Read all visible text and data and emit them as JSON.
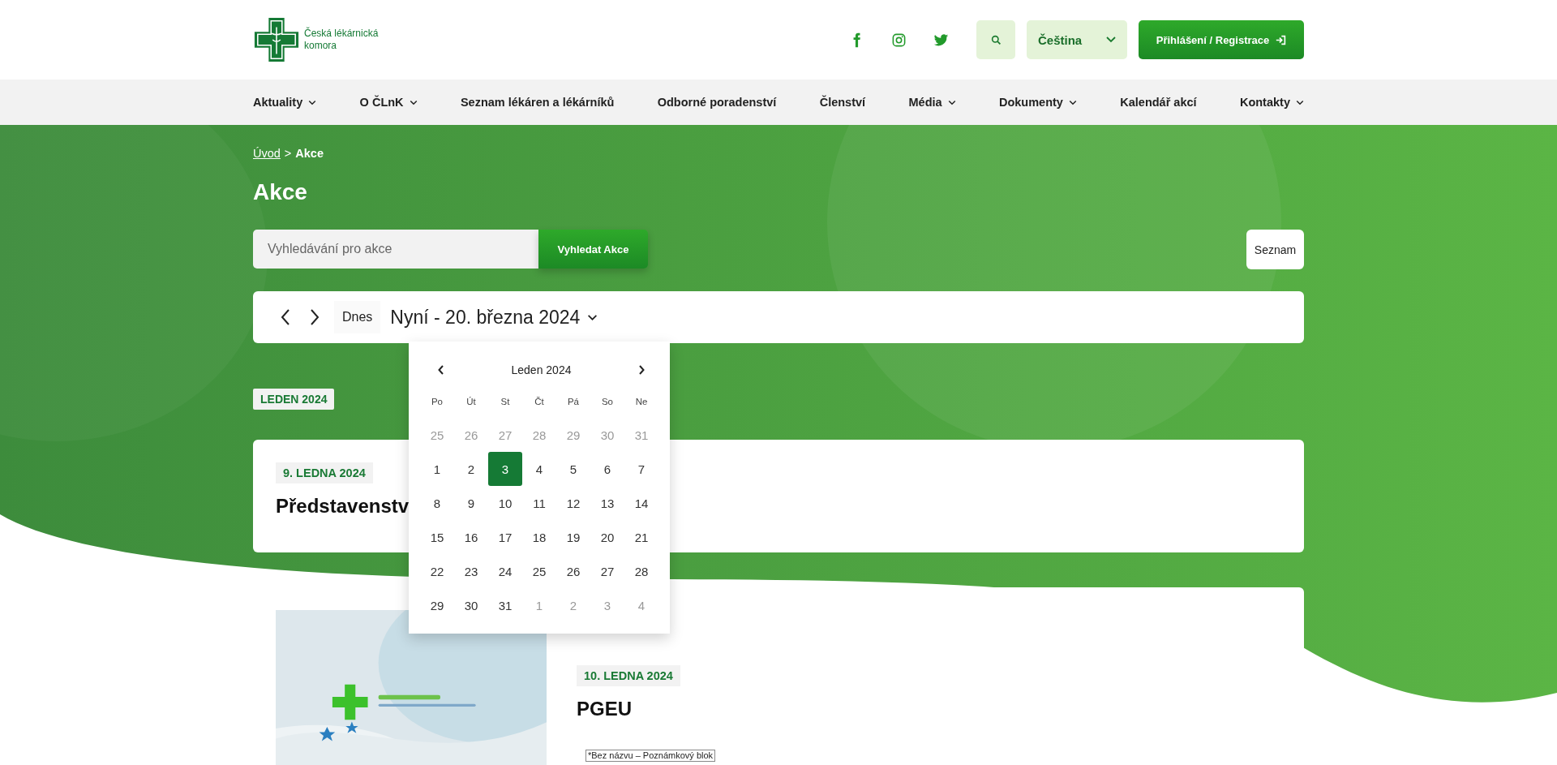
{
  "header": {
    "logo_text": "Česká lékárnická komora",
    "language": "Čeština",
    "login_button": "Přihlášení / Registrace"
  },
  "nav": [
    {
      "label": "Aktuality",
      "has_dropdown": true
    },
    {
      "label": "O ČLnK",
      "has_dropdown": true
    },
    {
      "label": "Seznam lékáren a lékárníků",
      "has_dropdown": false
    },
    {
      "label": "Odborné poradenství",
      "has_dropdown": false
    },
    {
      "label": "Členství",
      "has_dropdown": false
    },
    {
      "label": "Média",
      "has_dropdown": true
    },
    {
      "label": "Dokumenty",
      "has_dropdown": true
    },
    {
      "label": "Kalendář akcí",
      "has_dropdown": false
    },
    {
      "label": "Kontakty",
      "has_dropdown": true
    }
  ],
  "breadcrumb": {
    "link": "Úvod",
    "separator": ">",
    "current": "Akce"
  },
  "title": "Akce",
  "search": {
    "placeholder": "Vyhledávání pro akce",
    "button": "Vyhledat Akce"
  },
  "view_button": "Seznam",
  "toolbar": {
    "today": "Dnes",
    "range": "Nyní - 20. března 2024"
  },
  "datepicker": {
    "month": "Leden 2024",
    "weekdays": [
      "Po",
      "Út",
      "St",
      "Čt",
      "Pá",
      "So",
      "Ne"
    ],
    "days": [
      {
        "label": "25",
        "outside": true,
        "selected": false
      },
      {
        "label": "26",
        "outside": true,
        "selected": false
      },
      {
        "label": "27",
        "outside": true,
        "selected": false
      },
      {
        "label": "28",
        "outside": true,
        "selected": false
      },
      {
        "label": "29",
        "outside": true,
        "selected": false
      },
      {
        "label": "30",
        "outside": true,
        "selected": false
      },
      {
        "label": "31",
        "outside": true,
        "selected": false
      },
      {
        "label": "1",
        "outside": false,
        "selected": false
      },
      {
        "label": "2",
        "outside": false,
        "selected": false
      },
      {
        "label": "3",
        "outside": false,
        "selected": true
      },
      {
        "label": "4",
        "outside": false,
        "selected": false
      },
      {
        "label": "5",
        "outside": false,
        "selected": false
      },
      {
        "label": "6",
        "outside": false,
        "selected": false
      },
      {
        "label": "7",
        "outside": false,
        "selected": false
      },
      {
        "label": "8",
        "outside": false,
        "selected": false
      },
      {
        "label": "9",
        "outside": false,
        "selected": false
      },
      {
        "label": "10",
        "outside": false,
        "selected": false
      },
      {
        "label": "11",
        "outside": false,
        "selected": false
      },
      {
        "label": "12",
        "outside": false,
        "selected": false
      },
      {
        "label": "13",
        "outside": false,
        "selected": false
      },
      {
        "label": "14",
        "outside": false,
        "selected": false
      },
      {
        "label": "15",
        "outside": false,
        "selected": false
      },
      {
        "label": "16",
        "outside": false,
        "selected": false
      },
      {
        "label": "17",
        "outside": false,
        "selected": false
      },
      {
        "label": "18",
        "outside": false,
        "selected": false
      },
      {
        "label": "19",
        "outside": false,
        "selected": false
      },
      {
        "label": "20",
        "outside": false,
        "selected": false
      },
      {
        "label": "21",
        "outside": false,
        "selected": false
      },
      {
        "label": "22",
        "outside": false,
        "selected": false
      },
      {
        "label": "23",
        "outside": false,
        "selected": false
      },
      {
        "label": "24",
        "outside": false,
        "selected": false
      },
      {
        "label": "25",
        "outside": false,
        "selected": false
      },
      {
        "label": "26",
        "outside": false,
        "selected": false
      },
      {
        "label": "27",
        "outside": false,
        "selected": false
      },
      {
        "label": "28",
        "outside": false,
        "selected": false
      },
      {
        "label": "29",
        "outside": false,
        "selected": false
      },
      {
        "label": "30",
        "outside": false,
        "selected": false
      },
      {
        "label": "31",
        "outside": false,
        "selected": false
      },
      {
        "label": "1",
        "outside": true,
        "selected": false
      },
      {
        "label": "2",
        "outside": true,
        "selected": false
      },
      {
        "label": "3",
        "outside": true,
        "selected": false
      },
      {
        "label": "4",
        "outside": true,
        "selected": false
      }
    ]
  },
  "month_tag": "LEDEN 2024",
  "events": [
    {
      "date": "9. LEDNA 2024",
      "title": "Představenstv",
      "kind": "text"
    },
    {
      "date": "10. LEDNA 2024",
      "title": "PGEU",
      "kind": "picture",
      "note": "*Bez názvu – Poznámkový blok"
    }
  ]
}
